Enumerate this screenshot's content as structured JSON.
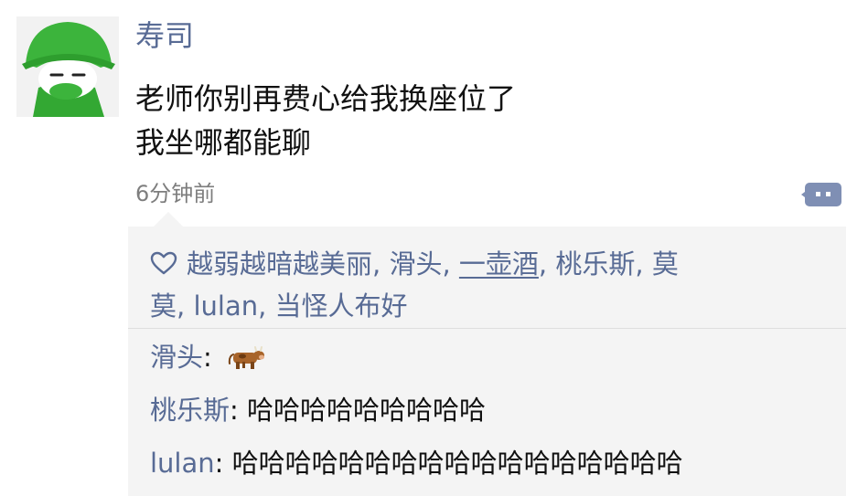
{
  "post": {
    "username": "寿司",
    "text_lines": [
      "老师你别再费心给我换座位了",
      "我坐哪都能聊"
    ],
    "time": "6分钟前",
    "avatar_icon": "green-hooded-character-avatar",
    "comment_icon": "comment-dots-icon"
  },
  "likes": {
    "icon": "heart-outline-icon",
    "line1": [
      {
        "name": "越弱越暗越美丽",
        "sep": ", "
      },
      {
        "name": "滑头",
        "sep": ", "
      },
      {
        "name": "一壶酒",
        "sep": ", ",
        "underlined": true
      },
      {
        "name": "桃乐斯",
        "sep": ", "
      },
      {
        "name": "莫"
      }
    ],
    "line2": [
      {
        "name": "莫",
        "sep": ", "
      },
      {
        "name": "lulan",
        "sep": ", "
      },
      {
        "name": "当怪人布好"
      }
    ]
  },
  "comments": [
    {
      "name": "滑头",
      "separator": ": ",
      "text": "",
      "emoji": "cow-emoji-icon"
    },
    {
      "name": "桃乐斯",
      "separator": ": ",
      "text": "哈哈哈哈哈哈哈哈哈"
    },
    {
      "name": "lulan",
      "separator": ": ",
      "text": "哈哈哈哈哈哈哈哈哈哈哈哈哈哈哈哈哈"
    }
  ],
  "colors": {
    "link_blue": "#586b95",
    "text_dark": "#111111",
    "time_grey": "#7e7e7e",
    "avatar_green": "#3cb43c",
    "panel_bg": "#f4f4f4"
  }
}
